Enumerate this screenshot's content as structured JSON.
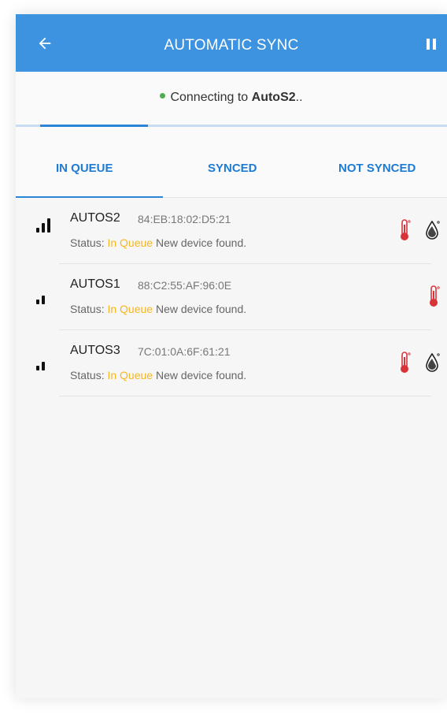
{
  "header": {
    "title": "AUTOMATIC SYNC",
    "back_icon": "arrow-left-icon",
    "pause_icon": "pause-icon"
  },
  "connection": {
    "prefix": "Connecting to ",
    "device": "AutoS2",
    "suffix": "..",
    "progress": 0.25
  },
  "tabs": [
    {
      "label": "IN QUEUE",
      "active": true
    },
    {
      "label": "SYNCED",
      "active": false
    },
    {
      "label": "NOT SYNCED",
      "active": false
    }
  ],
  "devices": [
    {
      "name": "AUTOS2",
      "mac": "84:EB:18:02:D5:21",
      "status_label": "Status: ",
      "status_value": "In Queue",
      "message": " New device found.",
      "signal_bars": 3,
      "thermometer": true,
      "humidity": true
    },
    {
      "name": "AUTOS1",
      "mac": "88:C2:55:AF:96:0E",
      "status_label": "Status: ",
      "status_value": "In Queue",
      "message": " New device found.",
      "signal_bars": 2,
      "thermometer": true,
      "humidity": false
    },
    {
      "name": "AUTOS3",
      "mac": "7C:01:0A:6F:61:21",
      "status_label": "Status: ",
      "status_value": "In Queue",
      "message": " New device found.",
      "signal_bars": 2,
      "thermometer": true,
      "humidity": true
    }
  ],
  "colors": {
    "appbar": "#3d93e0",
    "accent": "#2b84d6",
    "queue": "#f5b623",
    "connected_dot": "#4caf50",
    "thermometer": "#d9333a"
  }
}
